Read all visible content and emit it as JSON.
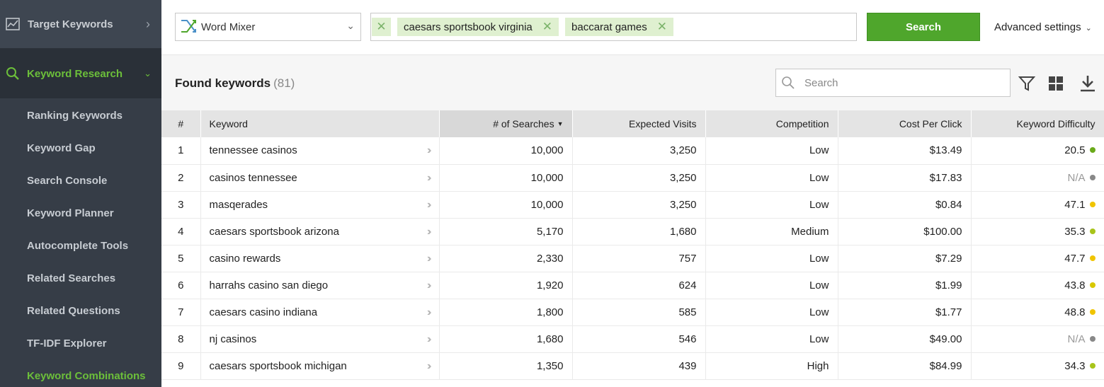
{
  "sidebar": {
    "target_keywords": "Target Keywords",
    "keyword_research": "Keyword Research",
    "items": [
      {
        "label": "Ranking Keywords"
      },
      {
        "label": "Keyword Gap"
      },
      {
        "label": "Search Console"
      },
      {
        "label": "Keyword Planner"
      },
      {
        "label": "Autocomplete Tools"
      },
      {
        "label": "Related Searches"
      },
      {
        "label": "Related Questions"
      },
      {
        "label": "TF-IDF Explorer"
      },
      {
        "label": "Keyword Combinations"
      }
    ],
    "accent": "#6cbf3a"
  },
  "toolbar": {
    "mixer_label": "Word Mixer",
    "tags": [
      "caesars sportsbook virginia",
      "baccarat games"
    ],
    "search_label": "Search",
    "advanced_label": "Advanced settings",
    "button_color": "#4fa62c"
  },
  "results": {
    "title": "Found keywords",
    "count": "(81)",
    "search_placeholder": "Search"
  },
  "table": {
    "columns": [
      "#",
      "Keyword",
      "# of Searches",
      "Expected Visits",
      "Competition",
      "Cost Per Click",
      "Keyword Difficulty"
    ],
    "rows": [
      {
        "idx": "1",
        "keyword": "tennessee casinos",
        "searches": "10,000",
        "visits": "3,250",
        "competition": "Low",
        "cpc": "$13.49",
        "difficulty": "20.5",
        "dot": "#6aaa1a"
      },
      {
        "idx": "2",
        "keyword": "casinos tennessee",
        "searches": "10,000",
        "visits": "3,250",
        "competition": "Low",
        "cpc": "$17.83",
        "difficulty": "N/A",
        "dot": "#888888"
      },
      {
        "idx": "3",
        "keyword": "masqerades",
        "searches": "10,000",
        "visits": "3,250",
        "competition": "Low",
        "cpc": "$0.84",
        "difficulty": "47.1",
        "dot": "#f0c400"
      },
      {
        "idx": "4",
        "keyword": "caesars sportsbook arizona",
        "searches": "5,170",
        "visits": "1,680",
        "competition": "Medium",
        "cpc": "$100.00",
        "difficulty": "35.3",
        "dot": "#a8c41a"
      },
      {
        "idx": "5",
        "keyword": "casino rewards",
        "searches": "2,330",
        "visits": "757",
        "competition": "Low",
        "cpc": "$7.29",
        "difficulty": "47.7",
        "dot": "#f0c400"
      },
      {
        "idx": "6",
        "keyword": "harrahs casino san diego",
        "searches": "1,920",
        "visits": "624",
        "competition": "Low",
        "cpc": "$1.99",
        "difficulty": "43.8",
        "dot": "#d8c800"
      },
      {
        "idx": "7",
        "keyword": "caesars casino indiana",
        "searches": "1,800",
        "visits": "585",
        "competition": "Low",
        "cpc": "$1.77",
        "difficulty": "48.8",
        "dot": "#f0c400"
      },
      {
        "idx": "8",
        "keyword": "nj casinos",
        "searches": "1,680",
        "visits": "546",
        "competition": "Low",
        "cpc": "$49.00",
        "difficulty": "N/A",
        "dot": "#888888"
      },
      {
        "idx": "9",
        "keyword": "caesars sportsbook michigan",
        "searches": "1,350",
        "visits": "439",
        "competition": "High",
        "cpc": "$84.99",
        "difficulty": "34.3",
        "dot": "#a8c41a"
      }
    ]
  }
}
